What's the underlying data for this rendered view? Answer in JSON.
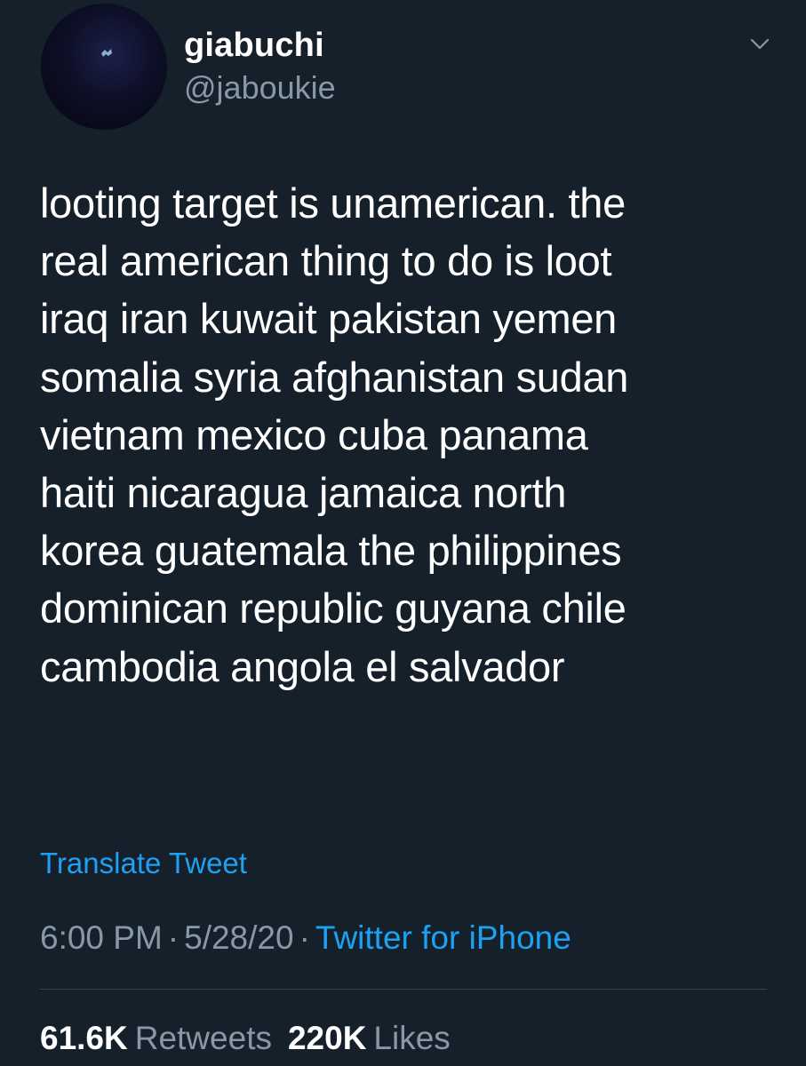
{
  "author": {
    "display_name": "giabuchi",
    "handle": "@jaboukie",
    "avatar_icon": "avatar-image"
  },
  "tweet": {
    "lines": [
      "looting target is unamerican. the",
      "real american thing to do is loot",
      "iraq iran kuwait pakistan yemen",
      "somalia syria afghanistan sudan",
      "vietnam mexico cuba panama",
      "haiti nicaragua jamaica north",
      "korea guatemala the philippines",
      "dominican republic guyana chile",
      "cambodia angola el salvador"
    ],
    "translate_label": "Translate Tweet"
  },
  "meta": {
    "time": "6:00 PM",
    "date": "5/28/20",
    "separator": "·",
    "source": "Twitter for iPhone"
  },
  "stats": {
    "retweets_count": "61.6K",
    "retweets_label": "Retweets",
    "likes_count": "220K",
    "likes_label": "Likes"
  },
  "colors": {
    "background": "#15202b",
    "text": "#ffffff",
    "secondary": "#8899a6",
    "accent": "#1da1f2",
    "divider": "#38444d"
  }
}
